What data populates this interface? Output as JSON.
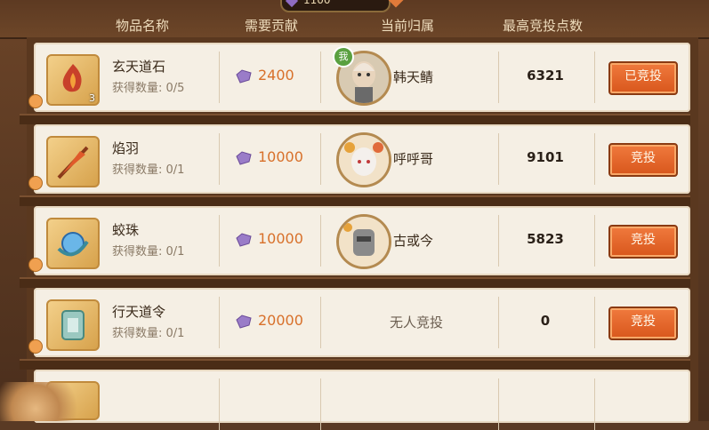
{
  "currency_display": "1100",
  "headers": {
    "item_name": "物品名称",
    "required_contribution": "需要贡献",
    "current_owner": "当前归属",
    "max_bid_points": "最高竞投点数"
  },
  "rows": [
    {
      "name": "玄天道石",
      "obtained": "获得数量: 0/5",
      "icon_count": "3",
      "icon": "flame-stone-icon",
      "contribution": "2400",
      "owner": "韩天鲭",
      "owner_badge": "我",
      "max_bid": "6321",
      "button": "已竞投"
    },
    {
      "name": "焰羽",
      "obtained": "获得数量: 0/1",
      "icon": "flame-feather-icon",
      "contribution": "10000",
      "owner": "呼呼哥",
      "max_bid": "9101",
      "button": "竞投"
    },
    {
      "name": "蛟珠",
      "obtained": "获得数量: 0/1",
      "icon": "dragon-pearl-icon",
      "contribution": "10000",
      "owner": "古或今",
      "max_bid": "5823",
      "button": "竞投"
    },
    {
      "name": "行天道令",
      "obtained": "获得数量: 0/1",
      "icon": "token-icon",
      "contribution": "20000",
      "owner_status": "无人竞投",
      "max_bid": "0",
      "button": "竞投"
    }
  ],
  "colors": {
    "accent_orange": "#d8702a",
    "bid_button": "#e8622a",
    "row_bg": "#f5efe4",
    "frame_brown": "#5a381f"
  }
}
